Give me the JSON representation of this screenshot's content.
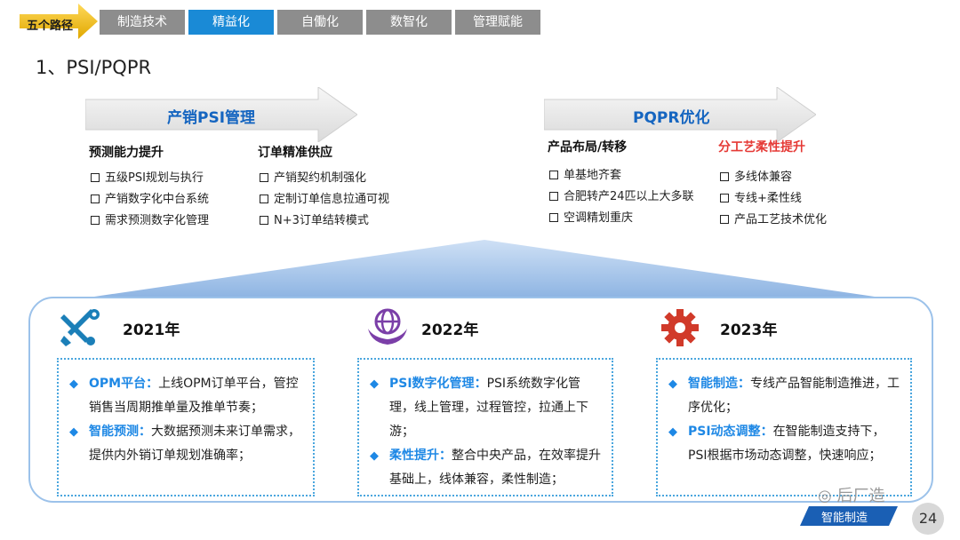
{
  "nav": {
    "path_label": "五个路径",
    "tabs": [
      {
        "label": "制造技术",
        "active": false
      },
      {
        "label": "精益化",
        "active": true
      },
      {
        "label": "自働化",
        "active": false
      },
      {
        "label": "数智化",
        "active": false
      },
      {
        "label": "管理赋能",
        "active": false
      }
    ]
  },
  "title": "1、PSI/PQPR",
  "left_arrow": {
    "label": "产销PSI管理",
    "col1": {
      "head": "预测能力提升",
      "items": [
        "五级PSI规划与执行",
        "产销数字化中台系统",
        "需求预测数字化管理"
      ]
    },
    "col2": {
      "head": "订单精准供应",
      "items": [
        "产销契约机制强化",
        "定制订单信息拉通可视",
        "N+3订单结转模式"
      ]
    }
  },
  "right_arrow": {
    "label": "PQPR优化",
    "col1": {
      "head": "产品布局/转移",
      "items": [
        "单基地齐套",
        "合肥转产24匹以上大多联",
        "空调精划重庆"
      ]
    },
    "col2": {
      "head": "分工艺柔性提升",
      "items": [
        "多线体兼容",
        "专线+柔性线",
        "产品工艺技术优化"
      ]
    }
  },
  "years": [
    {
      "year": "2021年",
      "icon": "tools-icon",
      "items": [
        {
          "key": "OPM平台",
          "sep": "：",
          "text": "上线OPM订单平台，管控销售当周期推单量及推单节奏；"
        },
        {
          "key": "智能预测",
          "sep": "：",
          "text": "大数据预测未来订单需求，提供内外销订单规划准确率；"
        }
      ]
    },
    {
      "year": "2022年",
      "icon": "globe-hands-icon",
      "items": [
        {
          "key": "PSI数字化管理",
          "sep": "：",
          "text": "PSI系统数字化管理，线上管理，过程管控，拉通上下游；"
        },
        {
          "key": "柔性提升",
          "sep": "：",
          "text": "整合中央产品，在效率提升基础上，线体兼容，柔性制造；"
        }
      ]
    },
    {
      "year": "2023年",
      "icon": "gear-icon",
      "items": [
        {
          "key": "智能制造",
          "sep": "：",
          "text": "专线产品智能制造推进，工序优化；"
        },
        {
          "key": "PSI动态调整",
          "sep": "：",
          "text": "在智能制造支持下，PSI根据市场动态调整，快速响应；"
        }
      ]
    }
  ],
  "watermark": "后厂造",
  "badge": "智能制造",
  "page_number": "24",
  "colors": {
    "accent": "#1a8ad6",
    "tab_gray": "#8d8d8d",
    "highlight_red": "#e53935",
    "key_blue": "#1e88e5",
    "frame": "#9cc2ea"
  }
}
